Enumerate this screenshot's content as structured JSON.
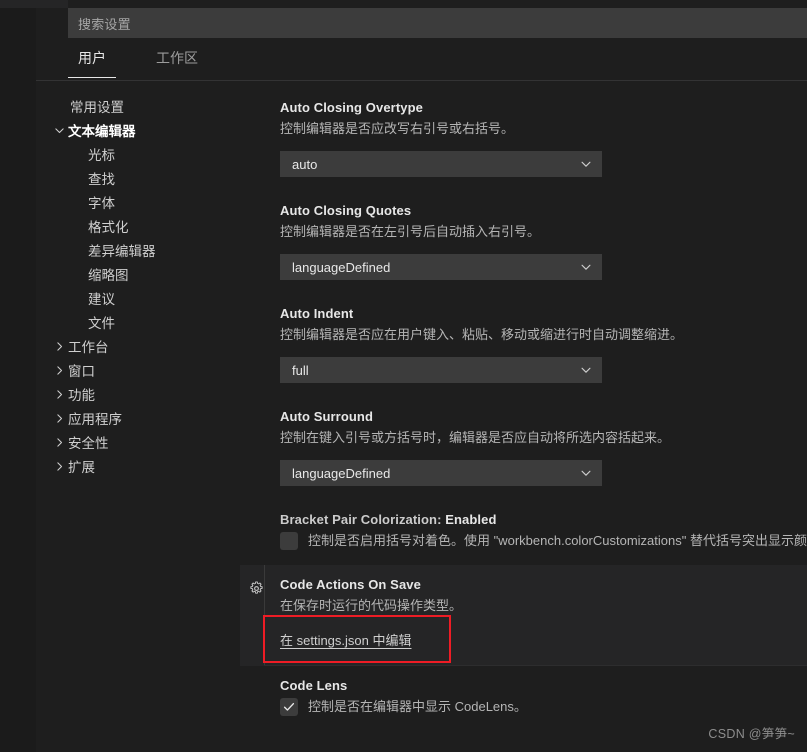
{
  "window": {
    "background_color": "#1e1e1e"
  },
  "search": {
    "placeholder": "搜索设置",
    "value": ""
  },
  "tabs": [
    {
      "label": "用户",
      "active": true
    },
    {
      "label": "工作区",
      "active": false
    }
  ],
  "sidebar": {
    "items": [
      {
        "label": "常用设置",
        "level": "top",
        "twisty": "none"
      },
      {
        "label": "文本编辑器",
        "level": "top",
        "twisty": "chevron-down-icon",
        "expanded": true
      },
      {
        "label": "光标",
        "level": "child",
        "twisty": "none"
      },
      {
        "label": "查找",
        "level": "child",
        "twisty": "none"
      },
      {
        "label": "字体",
        "level": "child",
        "twisty": "none"
      },
      {
        "label": "格式化",
        "level": "child",
        "twisty": "none"
      },
      {
        "label": "差异编辑器",
        "level": "child",
        "twisty": "none"
      },
      {
        "label": "缩略图",
        "level": "child",
        "twisty": "none"
      },
      {
        "label": "建议",
        "level": "child",
        "twisty": "none"
      },
      {
        "label": "文件",
        "level": "child",
        "twisty": "none"
      },
      {
        "label": "工作台",
        "level": "top",
        "twisty": "chevron-right-icon",
        "expanded": false
      },
      {
        "label": "窗口",
        "level": "top",
        "twisty": "chevron-right-icon",
        "expanded": false
      },
      {
        "label": "功能",
        "level": "top",
        "twisty": "chevron-right-icon",
        "expanded": false
      },
      {
        "label": "应用程序",
        "level": "top",
        "twisty": "chevron-right-icon",
        "expanded": false
      },
      {
        "label": "安全性",
        "level": "top",
        "twisty": "chevron-right-icon",
        "expanded": false
      },
      {
        "label": "扩展",
        "level": "top",
        "twisty": "chevron-right-icon",
        "expanded": false
      }
    ]
  },
  "settings": [
    {
      "id": "auto-closing-overtype",
      "title": "Auto Closing Overtype",
      "description": "控制编辑器是否应改写右引号或右括号。",
      "control": "dropdown",
      "value": "auto"
    },
    {
      "id": "auto-closing-quotes",
      "title": "Auto Closing Quotes",
      "description": "控制编辑器是否在左引号后自动插入右引号。",
      "control": "dropdown",
      "value": "languageDefined"
    },
    {
      "id": "auto-indent",
      "title": "Auto Indent",
      "description": "控制编辑器是否应在用户键入、粘贴、移动或缩进行时自动调整缩进。",
      "control": "dropdown",
      "value": "full"
    },
    {
      "id": "auto-surround",
      "title": "Auto Surround",
      "description": "控制在键入引号或方括号时，编辑器是否应自动将所选内容括起来。",
      "control": "dropdown",
      "value": "languageDefined"
    },
    {
      "id": "bracket-pair-colorization-enabled",
      "title_prefix": "Bracket Pair Colorization: ",
      "title_suffix": "Enabled",
      "description": "控制是否启用括号对着色。使用 \"workbench.colorCustomizations\" 替代括号突出显示颜色。",
      "control": "checkbox",
      "checked": false
    },
    {
      "id": "code-actions-on-save",
      "title": "Code Actions On Save",
      "description": "在保存时运行的代码操作类型。",
      "control": "json-link",
      "link_label": "在 settings.json 中编辑",
      "gear_icon": "gear-icon",
      "highlighted": true,
      "annotation_color": "#ee1c25"
    },
    {
      "id": "code-lens",
      "title": "Code Lens",
      "description": "控制是否在编辑器中显示 CodeLens。",
      "control": "checkbox",
      "checked": true
    }
  ],
  "watermark": {
    "text": "CSDN @笋笋~"
  }
}
